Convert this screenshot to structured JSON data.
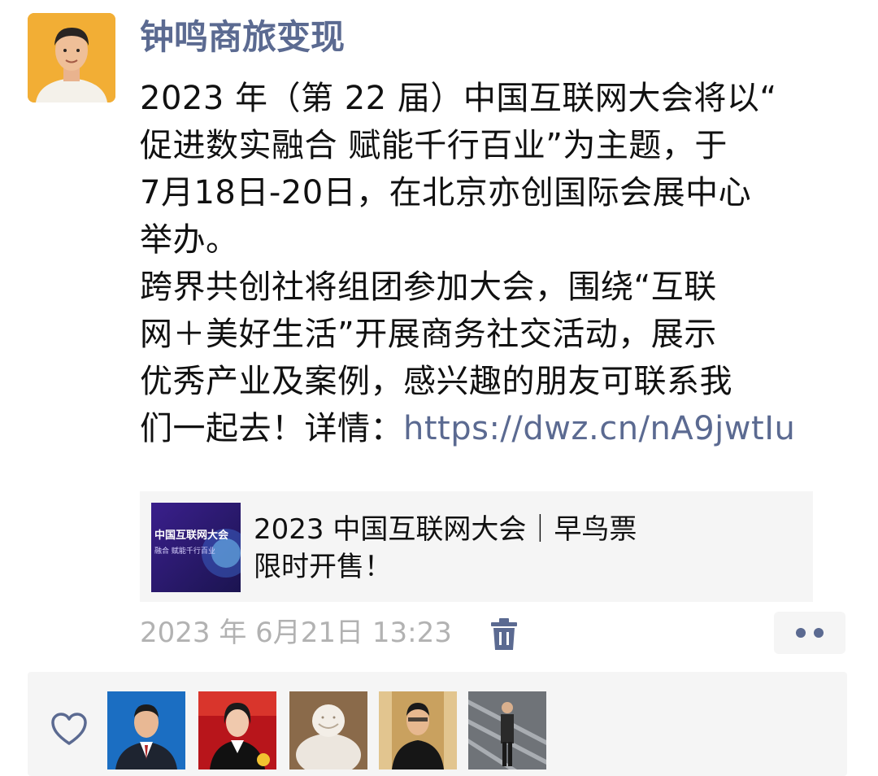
{
  "post": {
    "author": "钟鸣商旅变现",
    "lines": [
      "2023 年（第 22 届）中国互联网大会将以“",
      "促进数实融合 赋能千行百业”为主题，于",
      "7月18日-20日，在北京亦创国际会展中心",
      "举办。",
      "跨界共创社将组团参加大会，围绕“互联",
      "网＋美好生活”开展商务社交活动，展示",
      "优秀产业及案例，感兴趣的朋友可联系我"
    ],
    "last_line_text": "们一起去！详情：",
    "link_text": "https://dwz.cn/nA9jwtIu",
    "card": {
      "title_line1": "2023 中国互联网大会｜早鸟票",
      "title_line2": "限时开售！",
      "thumb_text": "中国互联网大会",
      "thumb_sub": "融合 赋能千行百业"
    },
    "timestamp": "2023 年 6月21日 13:23"
  },
  "icons": {
    "delete": "trash-icon",
    "more": "more-dots-icon",
    "like": "heart-icon"
  },
  "colors": {
    "name_blue": "#5b6a91",
    "meta_gray": "#b2b2b2",
    "panel_bg": "#f5f5f5"
  }
}
